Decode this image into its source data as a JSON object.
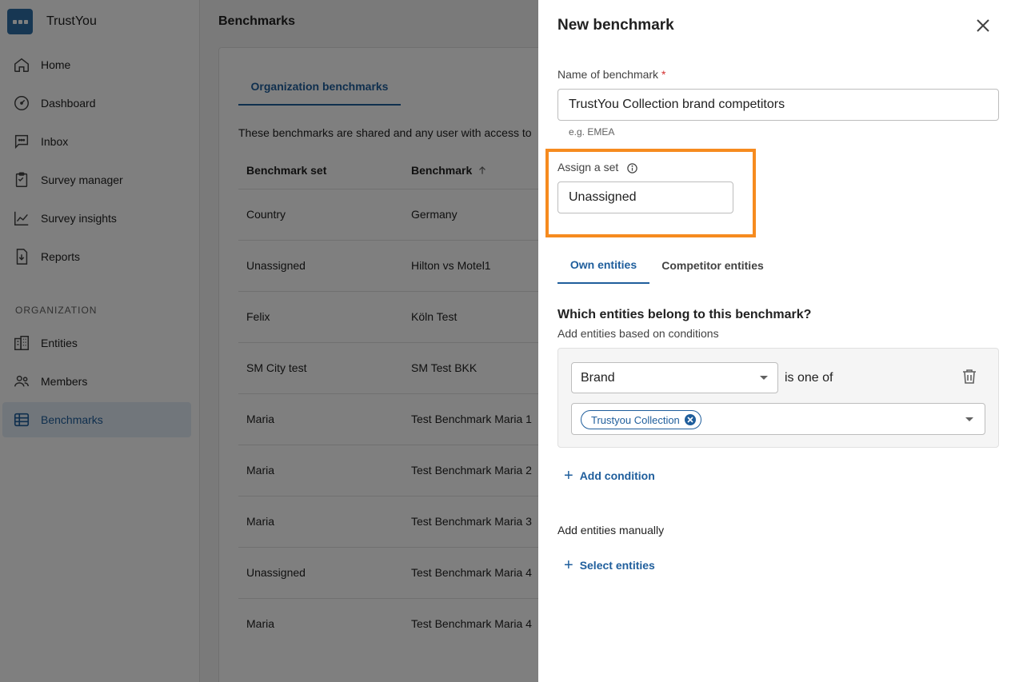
{
  "app": {
    "name": "TrustYou"
  },
  "sidebar": {
    "items": [
      {
        "label": "Home",
        "icon": "home-icon"
      },
      {
        "label": "Dashboard",
        "icon": "dashboard-icon"
      },
      {
        "label": "Inbox",
        "icon": "inbox-icon"
      },
      {
        "label": "Survey manager",
        "icon": "clipboard-icon"
      },
      {
        "label": "Survey insights",
        "icon": "chart-line-icon"
      },
      {
        "label": "Reports",
        "icon": "report-icon"
      }
    ],
    "section_label": "ORGANIZATION",
    "org_items": [
      {
        "label": "Entities",
        "icon": "building-icon"
      },
      {
        "label": "Members",
        "icon": "people-icon"
      },
      {
        "label": "Benchmarks",
        "icon": "table-icon",
        "active": true
      }
    ]
  },
  "main": {
    "title": "Benchmarks",
    "tab": "Organization benchmarks",
    "description": "These benchmarks are shared and any user with access to",
    "columns": {
      "set": "Benchmark set",
      "benchmark": "Benchmark"
    },
    "rows": [
      {
        "set": "Country",
        "benchmark": "Germany"
      },
      {
        "set": "Unassigned",
        "benchmark": "Hilton vs Motel1"
      },
      {
        "set": "Felix",
        "benchmark": "Köln Test"
      },
      {
        "set": "SM City test",
        "benchmark": "SM Test BKK"
      },
      {
        "set": "Maria",
        "benchmark": "Test Benchmark Maria 1"
      },
      {
        "set": "Maria",
        "benchmark": "Test Benchmark Maria 2"
      },
      {
        "set": "Maria",
        "benchmark": "Test Benchmark Maria 3"
      },
      {
        "set": "Unassigned",
        "benchmark": "Test Benchmark Maria 4"
      },
      {
        "set": "Maria",
        "benchmark": "Test Benchmark Maria 4"
      }
    ]
  },
  "drawer": {
    "title": "New benchmark",
    "name_label": "Name of benchmark",
    "required_mark": "*",
    "name_value": "TrustYou Collection brand competitors",
    "name_hint": "e.g. EMEA",
    "set_label": "Assign a set",
    "set_value": "Unassigned",
    "tabs": {
      "own": "Own entities",
      "competitor": "Competitor entities"
    },
    "question": "Which entities belong to this benchmark?",
    "conditions_subtitle": "Add entities based on conditions",
    "condition": {
      "field": "Brand",
      "operator": "is one of",
      "chips": [
        "Trustyou Collection"
      ]
    },
    "add_condition": "Add condition",
    "manual_label": "Add entities manually",
    "select_entities": "Select entities",
    "highlight_color": "#f68b1f",
    "accent_color": "#1f5e9c"
  }
}
